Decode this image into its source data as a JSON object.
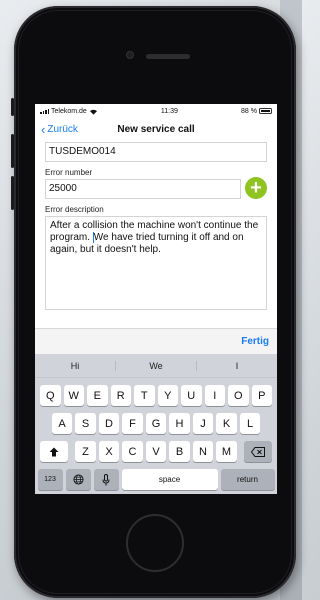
{
  "status_bar": {
    "carrier": "Telekom.de",
    "time": "11:39",
    "battery": "88 %"
  },
  "nav": {
    "back_label": "Zurück",
    "title": "New service call"
  },
  "form": {
    "id_value": "TUSDEMO014",
    "error_number_label": "Error number",
    "error_number_value": "25000",
    "error_description_label": "Error description",
    "error_description_before": "After a collision the machine won't continue the program. ",
    "error_description_after": "We have tried turning it off and on again, but it doesn't help."
  },
  "toolbar": {
    "done_label": "Fertig"
  },
  "keyboard": {
    "suggestions": [
      "Hi",
      "We",
      "I"
    ],
    "row1": [
      "Q",
      "W",
      "E",
      "R",
      "T",
      "Y",
      "U",
      "I",
      "O",
      "P"
    ],
    "row2": [
      "A",
      "S",
      "D",
      "F",
      "G",
      "H",
      "J",
      "K",
      "L"
    ],
    "row3": [
      "Z",
      "X",
      "C",
      "V",
      "B",
      "N",
      "M"
    ],
    "numbers_label": "123",
    "space_label": "space",
    "return_label": "return"
  },
  "icons": {
    "back": "chevron-left-icon",
    "add": "plus-circle-icon",
    "shift": "shift-icon",
    "delete": "backspace-icon",
    "globe": "globe-icon",
    "mic": "microphone-icon",
    "wifi": "wifi-icon",
    "battery": "battery-icon"
  },
  "colors": {
    "accent": "#1a7cf5",
    "add_button": "#8ec320",
    "keyboard_bg": "#d0d3d9"
  }
}
